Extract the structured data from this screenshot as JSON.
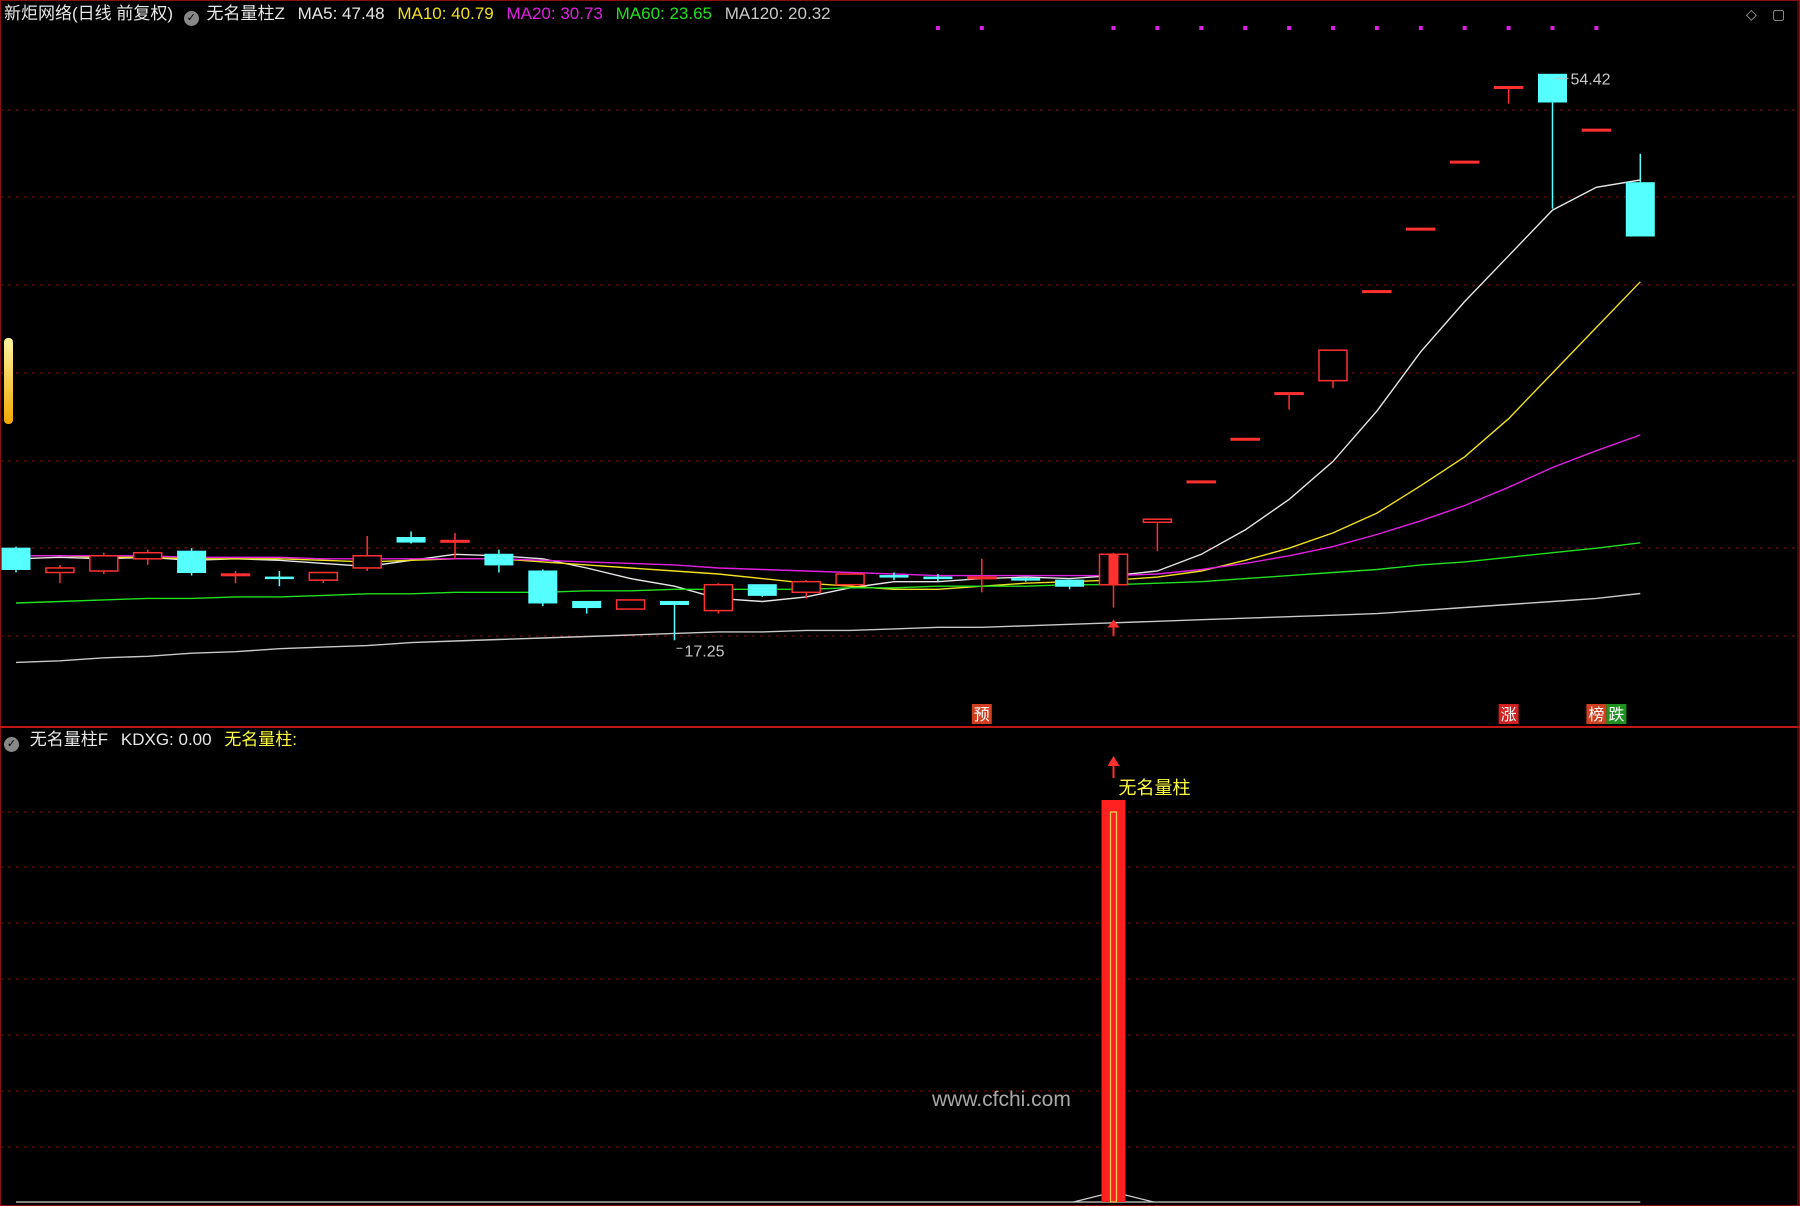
{
  "header_main": {
    "title": "新炬网络(日线 前复权)",
    "indicator": "无名量柱Z",
    "ma_labels": [
      {
        "text": "MA5: 47.48",
        "color": "#e6e6e6"
      },
      {
        "text": "MA10: 40.79",
        "color": "#f0e020"
      },
      {
        "text": "MA20: 30.73",
        "color": "#e020e0"
      },
      {
        "text": "MA60: 23.65",
        "color": "#20e020"
      },
      {
        "text": "MA120: 20.32",
        "color": "#c8c8c8"
      }
    ]
  },
  "header_sub": {
    "indicator": "无名量柱F",
    "kdxg": "KDXG: 0.00",
    "label": "无名量柱:"
  },
  "watermark": "www.cfchi.com",
  "colors": {
    "background": "#000000",
    "up": "#ff3030",
    "down": "#55ffff",
    "grid": "#7a1010",
    "signal_bar": "#ff2020",
    "signal_text": "#ffff40"
  },
  "chart_data": [
    {
      "type": "candlestick",
      "title": "新炬网络(日线 前复权)",
      "ylim": [
        13,
        57
      ],
      "candles": [
        {
          "o": 23.3,
          "h": 23.4,
          "l": 21.7,
          "c": 21.9
        },
        {
          "o": 21.7,
          "h": 22.2,
          "l": 21.0,
          "c": 22.0
        },
        {
          "o": 21.8,
          "h": 23.0,
          "l": 21.6,
          "c": 22.8
        },
        {
          "o": 22.6,
          "h": 23.2,
          "l": 22.2,
          "c": 23.0
        },
        {
          "o": 23.1,
          "h": 23.3,
          "l": 21.5,
          "c": 21.7
        },
        {
          "o": 21.6,
          "h": 21.8,
          "l": 21.0,
          "c": 21.6
        },
        {
          "o": 21.4,
          "h": 21.8,
          "l": 20.8,
          "c": 21.3
        },
        {
          "o": 21.2,
          "h": 21.6,
          "l": 21.0,
          "c": 21.7
        },
        {
          "o": 22.0,
          "h": 24.1,
          "l": 21.8,
          "c": 22.8
        },
        {
          "o": 24.0,
          "h": 24.4,
          "l": 23.6,
          "c": 23.7
        },
        {
          "o": 23.7,
          "h": 24.3,
          "l": 22.6,
          "c": 23.8
        },
        {
          "o": 22.9,
          "h": 23.2,
          "l": 21.7,
          "c": 22.2
        },
        {
          "o": 21.8,
          "h": 21.9,
          "l": 19.5,
          "c": 19.7
        },
        {
          "o": 19.8,
          "h": 19.8,
          "l": 19.0,
          "c": 19.4
        },
        {
          "o": 19.3,
          "h": 19.9,
          "l": 19.3,
          "c": 19.9
        },
        {
          "o": 19.8,
          "h": 19.8,
          "l": 17.25,
          "c": 19.6
        },
        {
          "o": 19.2,
          "h": 21.0,
          "l": 19.0,
          "c": 20.9
        },
        {
          "o": 20.9,
          "h": 20.9,
          "l": 20.1,
          "c": 20.2
        },
        {
          "o": 20.4,
          "h": 21.2,
          "l": 20.0,
          "c": 21.1
        },
        {
          "o": 20.9,
          "h": 21.5,
          "l": 20.9,
          "c": 21.6
        },
        {
          "o": 21.5,
          "h": 21.7,
          "l": 21.2,
          "c": 21.4
        },
        {
          "o": 21.4,
          "h": 21.6,
          "l": 21.1,
          "c": 21.3
        },
        {
          "o": 21.3,
          "h": 22.6,
          "l": 20.4,
          "c": 21.4
        },
        {
          "o": 21.3,
          "h": 21.4,
          "l": 21.1,
          "c": 21.2
        },
        {
          "o": 21.2,
          "h": 21.2,
          "l": 20.6,
          "c": 20.8
        },
        {
          "o": 20.9,
          "h": 23.0,
          "l": 19.4,
          "c": 22.9
        },
        {
          "o": 25.0,
          "h": 25.2,
          "l": 23.1,
          "c": 25.2
        },
        {
          "o": 27.7,
          "h": 27.7,
          "l": 27.7,
          "c": 27.7
        },
        {
          "o": 30.5,
          "h": 30.5,
          "l": 30.5,
          "c": 30.5
        },
        {
          "o": 33.5,
          "h": 33.5,
          "l": 32.4,
          "c": 33.5
        },
        {
          "o": 34.3,
          "h": 36.3,
          "l": 33.8,
          "c": 36.3
        },
        {
          "o": 40.2,
          "h": 40.2,
          "l": 40.2,
          "c": 40.2
        },
        {
          "o": 44.3,
          "h": 44.3,
          "l": 44.3,
          "c": 44.3
        },
        {
          "o": 48.7,
          "h": 48.7,
          "l": 48.7,
          "c": 48.7
        },
        {
          "o": 53.6,
          "h": 53.6,
          "l": 52.5,
          "c": 53.6
        },
        {
          "o": 54.42,
          "h": 54.42,
          "l": 45.6,
          "c": 52.6
        },
        {
          "o": 50.8,
          "h": 50.8,
          "l": 50.8,
          "c": 50.8
        },
        {
          "o": 47.3,
          "h": 49.2,
          "l": 43.8,
          "c": 43.8
        }
      ],
      "series": [
        {
          "name": "MA5",
          "color": "#e6e6e6",
          "values": [
            22.6,
            22.7,
            22.6,
            22.7,
            22.5,
            22.6,
            22.5,
            22.3,
            22.1,
            22.5,
            22.9,
            22.8,
            22.6,
            22.0,
            21.3,
            20.8,
            20.0,
            19.8,
            20.1,
            20.7,
            21.1,
            21.1,
            21.3,
            21.4,
            21.3,
            21.5,
            21.8,
            22.9,
            24.5,
            26.5,
            29.0,
            32.3,
            36.2,
            39.5,
            42.5,
            45.5,
            47.0,
            47.48
          ]
        },
        {
          "name": "MA10",
          "color": "#f0e020",
          "values": [
            22.8,
            22.8,
            22.7,
            22.7,
            22.6,
            22.6,
            22.6,
            22.5,
            22.4,
            22.5,
            22.6,
            22.6,
            22.4,
            22.2,
            22.0,
            21.8,
            21.6,
            21.3,
            21.0,
            20.8,
            20.6,
            20.6,
            20.8,
            21.0,
            21.1,
            21.2,
            21.4,
            21.8,
            22.5,
            23.3,
            24.3,
            25.6,
            27.4,
            29.3,
            31.8,
            34.8,
            37.8,
            40.79
          ]
        },
        {
          "name": "MA20",
          "color": "#e020e0",
          "values": [
            22.8,
            22.8,
            22.8,
            22.8,
            22.7,
            22.7,
            22.7,
            22.6,
            22.6,
            22.6,
            22.6,
            22.6,
            22.5,
            22.4,
            22.3,
            22.2,
            22.0,
            21.9,
            21.8,
            21.7,
            21.6,
            21.5,
            21.5,
            21.5,
            21.5,
            21.5,
            21.6,
            21.9,
            22.3,
            22.8,
            23.4,
            24.2,
            25.1,
            26.1,
            27.3,
            28.6,
            29.7,
            30.73
          ]
        },
        {
          "name": "MA60",
          "color": "#20e020",
          "values": [
            19.7,
            19.8,
            19.9,
            20.0,
            20.0,
            20.1,
            20.1,
            20.2,
            20.3,
            20.3,
            20.4,
            20.4,
            20.4,
            20.5,
            20.5,
            20.6,
            20.6,
            20.6,
            20.6,
            20.7,
            20.7,
            20.8,
            20.8,
            20.8,
            20.9,
            20.9,
            21.0,
            21.1,
            21.3,
            21.5,
            21.7,
            21.9,
            22.2,
            22.4,
            22.7,
            23.0,
            23.3,
            23.65
          ]
        },
        {
          "name": "MA120",
          "color": "#c8c8c8",
          "values": [
            15.8,
            15.9,
            16.1,
            16.2,
            16.4,
            16.5,
            16.7,
            16.8,
            16.9,
            17.1,
            17.2,
            17.3,
            17.4,
            17.5,
            17.6,
            17.7,
            17.8,
            17.8,
            17.9,
            17.9,
            18.0,
            18.1,
            18.1,
            18.2,
            18.3,
            18.4,
            18.5,
            18.6,
            18.7,
            18.8,
            18.9,
            19.0,
            19.2,
            19.4,
            19.6,
            19.8,
            20.0,
            20.32
          ]
        }
      ],
      "annotations": [
        {
          "text": "54.42",
          "index": 35,
          "value": 54.42
        },
        {
          "text": "17.25",
          "index": 15,
          "value": 17.25
        },
        {
          "text": "预",
          "index": 22,
          "kind": "badge",
          "bg": "#d04020",
          "fg": "#ffffff"
        },
        {
          "text": "涨",
          "index": 34,
          "kind": "badge",
          "bg": "#d02020",
          "fg": "#ffffff"
        },
        {
          "text": "榜",
          "index": 36,
          "kind": "badge",
          "bg": "#d04020",
          "fg": "#ffffff"
        },
        {
          "text": "跌",
          "index": 36,
          "kind": "badge",
          "bg": "#209020",
          "fg": "#ffffff"
        }
      ],
      "signal_arrow_index": 25,
      "top_dot_indices": [
        21,
        22,
        25,
        26,
        27,
        28,
        29,
        30,
        31,
        32,
        33,
        34,
        35,
        36
      ]
    },
    {
      "type": "bar",
      "title": "无名量柱F",
      "values": [
        0,
        0,
        0,
        0,
        0,
        0,
        0,
        0,
        0,
        0,
        0,
        0,
        0,
        0,
        0,
        0,
        0,
        0,
        0,
        0,
        0,
        0,
        0,
        0,
        0,
        1,
        0,
        0,
        0,
        0,
        0,
        0,
        0,
        0,
        0,
        0,
        0,
        0
      ],
      "signal_label": "无名量柱",
      "signal_index": 25
    }
  ]
}
